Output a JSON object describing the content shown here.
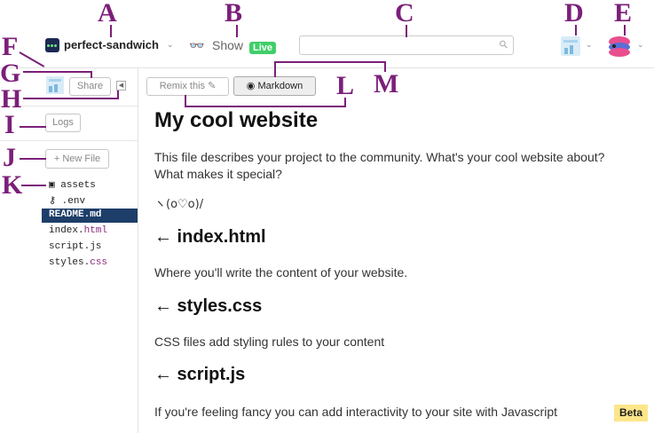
{
  "callouts": [
    "A",
    "B",
    "C",
    "D",
    "E",
    "F",
    "G",
    "H",
    "I",
    "J",
    "K",
    "L",
    "M"
  ],
  "project": {
    "name": "perfect-sandwich",
    "chevron": "⌄"
  },
  "show": {
    "icon": "sunglasses-icon",
    "label": "Show",
    "live_badge": "Live"
  },
  "search": {
    "placeholder": "",
    "icon": "search-icon"
  },
  "sidebar": {
    "share_label": "Share",
    "logs_label": "Logs",
    "new_file_label": "+ New File",
    "assets_label": "assets",
    "files": [
      ".env",
      "README.md",
      "index.html",
      "script.js",
      "styles.css"
    ],
    "selected_file": "README.md",
    "file_parts": {
      "env": ".env",
      "index_base": "index.",
      "index_ext": "html",
      "script": "script.js",
      "styles_base": "styles.",
      "styles_ext": "css"
    }
  },
  "toolbar": {
    "remix_label": "Remix this",
    "remix_icon": "magic-wand-icon",
    "markdown_label": "Markdown",
    "markdown_icon": "eye-icon"
  },
  "document": {
    "title": "My cool website",
    "intro": "This file describes your project to the community. What's your cool website about? What makes it special?",
    "emoticon": "ヽ(o♡o)/",
    "sections": [
      {
        "heading": "← index.html",
        "body": "Where you'll write the content of your website."
      },
      {
        "heading": "← styles.css",
        "body": "CSS files add styling rules to your content"
      },
      {
        "heading": "← script.js",
        "body": "If you're feeling fancy you can add interactivity to your site with Javascript"
      }
    ]
  },
  "beta_badge": "Beta",
  "colors": {
    "callout": "#7b1f79",
    "live": "#3fcf69",
    "selected_file_bg": "#1d3e69",
    "beta_bg": "#fce68a"
  }
}
